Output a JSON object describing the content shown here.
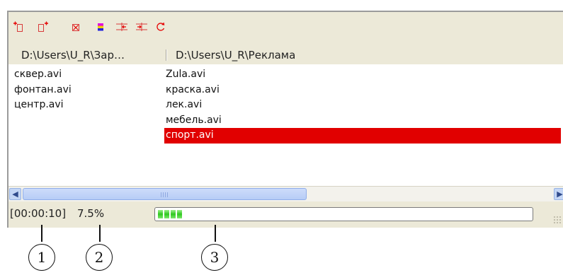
{
  "toolbar": {
    "buttons": [
      {
        "icon": "add-before-icon",
        "color": "#e60000"
      },
      {
        "icon": "add-after-icon",
        "color": "#e60000"
      },
      {
        "icon": "delete-icon",
        "color": "#e60000"
      },
      {
        "icon": "color-icon",
        "color": "#2222dd"
      },
      {
        "icon": "collapse-icon",
        "color": "#e60000"
      },
      {
        "icon": "expand-icon",
        "color": "#e60000"
      },
      {
        "icon": "refresh-icon",
        "color": "#e60000"
      }
    ]
  },
  "columns": {
    "left": {
      "header": "D:\\Users\\U_R\\Зар…",
      "items": [
        "сквер.avi",
        "фонтан.avi",
        "центр.avi"
      ]
    },
    "right": {
      "header": "D:\\Users\\U_R\\Реклама",
      "items": [
        "Zula.avi",
        "краска.avi",
        "лек.avi",
        "мебель.avi",
        "спорт.avi"
      ],
      "selected_index": 4
    }
  },
  "status": {
    "time": "[00:00:10]",
    "percent": "7.5%",
    "progress_fraction": 0.075
  },
  "callouts": [
    "1",
    "2",
    "3"
  ],
  "colors": {
    "selection": "#e10000",
    "progress": "#2fc820",
    "window_bg": "#ece9d8"
  }
}
